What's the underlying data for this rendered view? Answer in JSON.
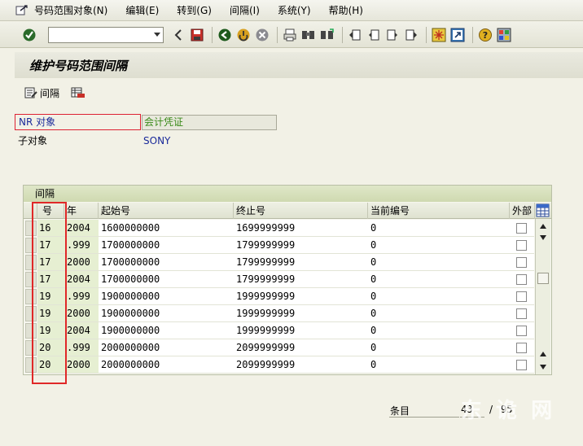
{
  "menubar": {
    "items": [
      "号码范围对象(N)",
      "编辑(E)",
      "转到(G)",
      "间隔(I)",
      "系统(Y)",
      "帮助(H)"
    ]
  },
  "toolbar": {
    "command_value": "",
    "icons": [
      "enter-icon",
      "back-icon",
      "save-icon",
      "back-nav-icon",
      "exit-icon",
      "cancel-icon",
      "print-icon",
      "find-icon",
      "find-next-icon",
      "first-page-icon",
      "prev-page-icon",
      "next-page-icon",
      "last-page-icon",
      "new-session-icon",
      "shortcut-icon",
      "help-icon",
      "customize-icon"
    ]
  },
  "title": "维护号码范围间隔",
  "app_toolbar": {
    "interval_label": "间隔"
  },
  "fields": {
    "nr_object_label": "NR 对象",
    "nr_object_value": "会计凭证",
    "sub_object_label": "子对象",
    "sub_object_value": "SONY"
  },
  "table": {
    "caption": "间隔",
    "headers": [
      "号",
      "年",
      "起始号",
      "终止号",
      "当前编号",
      "外部"
    ],
    "rows": [
      {
        "num": "16",
        "year": "2004",
        "start": "1600000000",
        "end": "1699999999",
        "current": "0"
      },
      {
        "num": "17",
        "year": ".999",
        "start": "1700000000",
        "end": "1799999999",
        "current": "0"
      },
      {
        "num": "17",
        "year": "2000",
        "start": "1700000000",
        "end": "1799999999",
        "current": "0"
      },
      {
        "num": "17",
        "year": "2004",
        "start": "1700000000",
        "end": "1799999999",
        "current": "0"
      },
      {
        "num": "19",
        "year": ".999",
        "start": "1900000000",
        "end": "1999999999",
        "current": "0"
      },
      {
        "num": "19",
        "year": "2000",
        "start": "1900000000",
        "end": "1999999999",
        "current": "0"
      },
      {
        "num": "19",
        "year": "2004",
        "start": "1900000000",
        "end": "1999999999",
        "current": "0"
      },
      {
        "num": "20",
        "year": ".999",
        "start": "2000000000",
        "end": "2099999999",
        "current": "0"
      },
      {
        "num": "20",
        "year": "2000",
        "start": "2000000000",
        "end": "2099999999",
        "current": "0"
      }
    ]
  },
  "footer": {
    "entries_label": "条目",
    "position": "43",
    "slash": "/",
    "total": "95"
  },
  "watermark": "东 诡 网",
  "colors": {
    "highlight": "#e02828",
    "link_blue": "#1a2a9a",
    "value_green": "#3a8a1a"
  }
}
